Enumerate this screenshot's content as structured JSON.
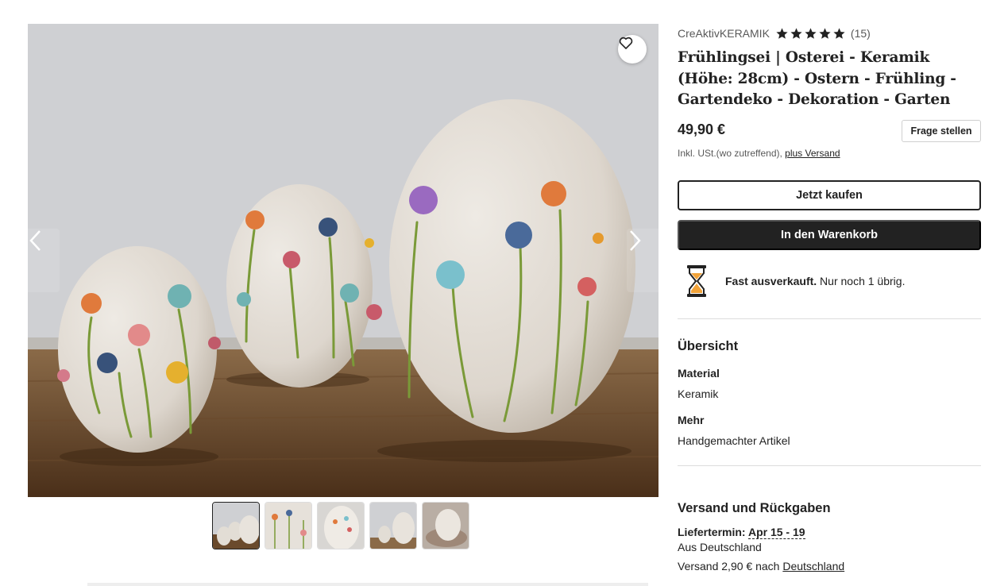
{
  "gallery": {
    "icons": {
      "favorite": "heart-outline-icon",
      "prev": "chevron-left-icon",
      "next": "chevron-right-icon"
    },
    "thumbnail_count": 5,
    "active_thumbnail": 1
  },
  "listing": {
    "shop_name": "CreAktivKERAMIK",
    "rating": 5,
    "reviews": "(15)",
    "title": "Frühlingsei | Osterei - Keramik (Höhe: 28cm) - Ostern - Frühling - Gartendeko - Dekoration - Garten",
    "price": "49,90 €",
    "ask_question": "Frage stellen",
    "tax_note": "Inkl. USt.(wo zutreffend), ",
    "plus_shipping": "plus Versand",
    "buy_now": "Jetzt kaufen",
    "add_to_cart": "In den Warenkorb",
    "stock_bold": "Fast ausverkauft.",
    "stock_rest": " Nur noch 1 übrig."
  },
  "overview": {
    "heading": "Übersicht",
    "material_label": "Material",
    "material_value": "Keramik",
    "more_label": "Mehr",
    "more_value": "Handgemachter Artikel"
  },
  "shipping": {
    "heading": "Versand und Rückgaben",
    "delivery_label": "Liefertermin: ",
    "delivery_dates": "Apr 15 - 19",
    "origin": "Aus Deutschland",
    "cost_prefix": "Versand 2,90 € nach ",
    "country": "Deutschland"
  },
  "colors": {
    "button_dark": "#222222",
    "text_muted": "#595959",
    "hourglass_sand": "#f1a33a"
  }
}
